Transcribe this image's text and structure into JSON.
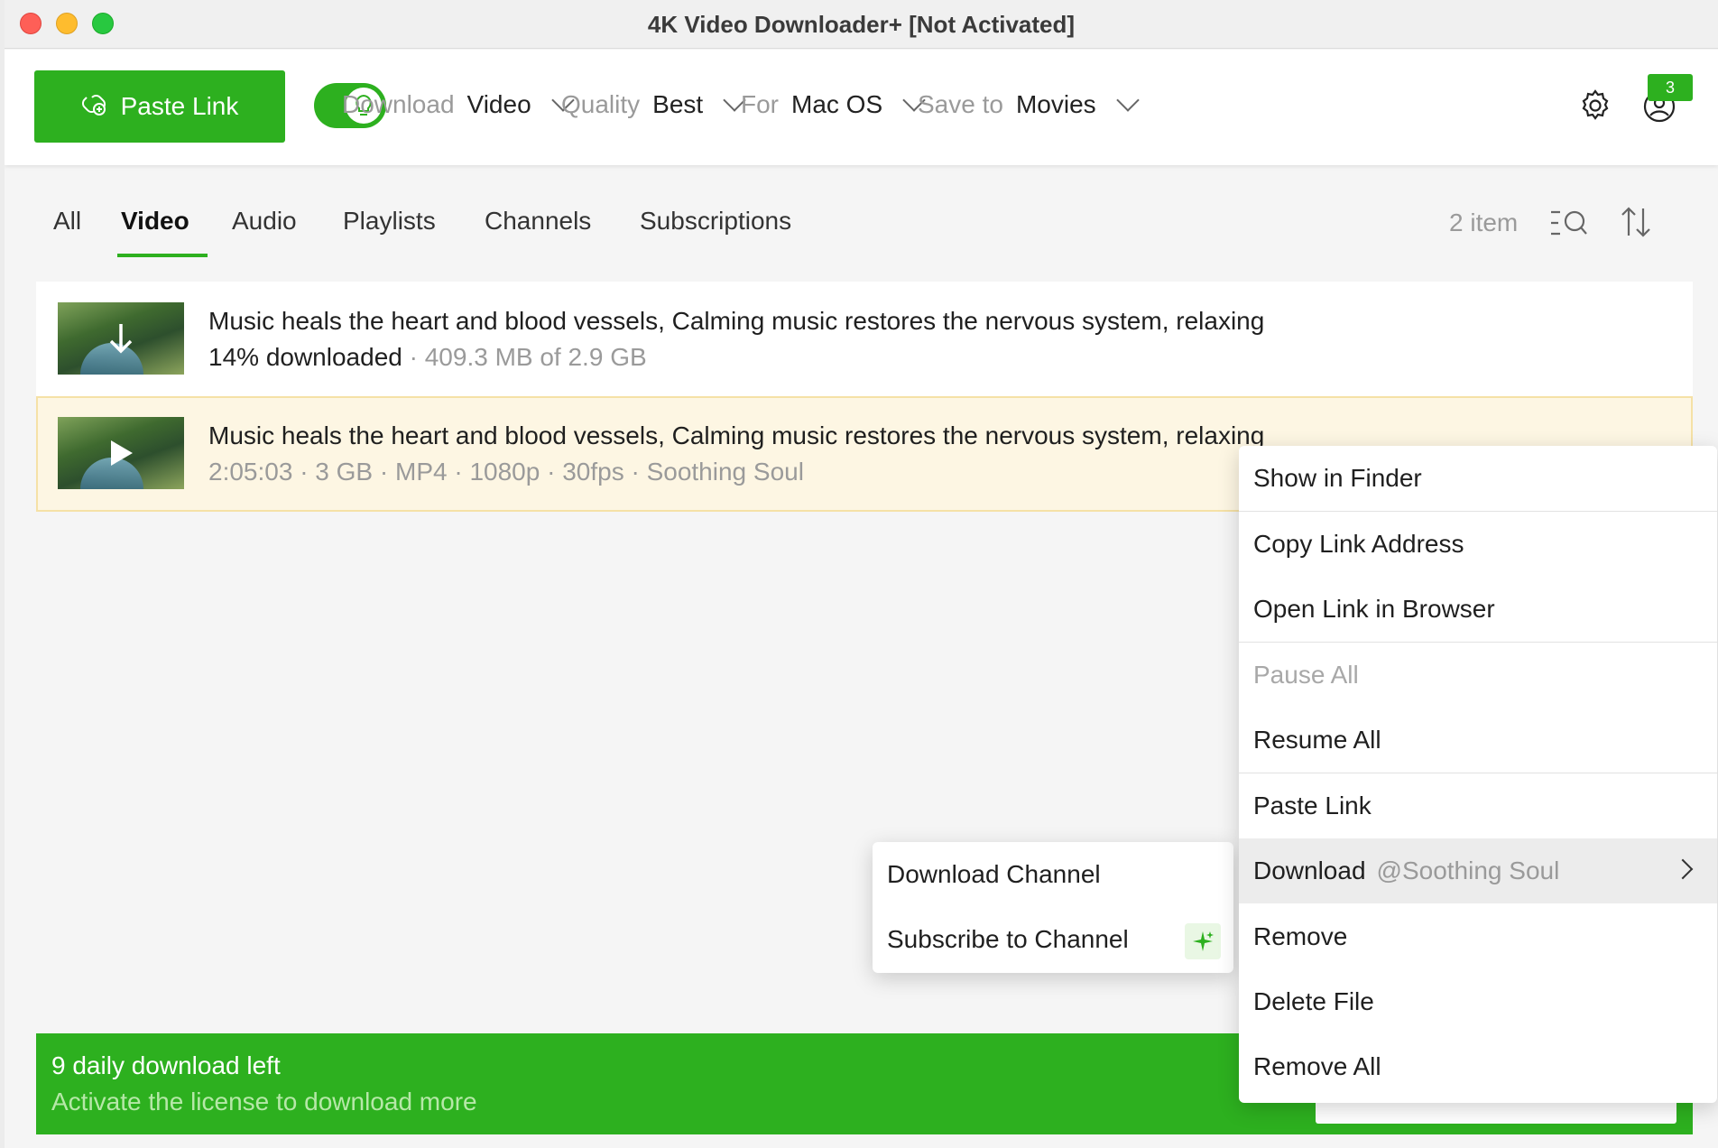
{
  "window": {
    "title": "4K Video Downloader+ [Not Activated]"
  },
  "toolbar": {
    "paste_link_label": "Paste Link",
    "download_label": "Download",
    "download_value": "Video",
    "quality_label": "Quality",
    "quality_value": "Best",
    "for_label": "For",
    "for_value": "Mac OS",
    "save_label": "Save to",
    "save_value": "Movies",
    "notifications_count": "3",
    "accent_color": "#2db01f"
  },
  "tabs": [
    {
      "label": "All"
    },
    {
      "label": "Video"
    },
    {
      "label": "Audio"
    },
    {
      "label": "Playlists"
    },
    {
      "label": "Channels"
    },
    {
      "label": "Subscriptions"
    }
  ],
  "list": {
    "count_text": "2 item",
    "items": [
      {
        "title": "Music heals the heart and blood vessels, Calming music restores the nervous system, relaxing",
        "progress": "14% downloaded",
        "size": " · 409.3 MB of 2.9 GB",
        "status_icon": "download-arrow-icon"
      },
      {
        "title": "Music heals the heart and blood vessels, Calming music restores the nervous system, relaxing",
        "meta": "2:05:03 · 3 GB · MP4 · 1080p · 30fps · Soothing Soul",
        "status_icon": "play-icon"
      }
    ]
  },
  "banner": {
    "line1": "9 daily download left",
    "line2": "Activate the license to download more"
  },
  "context_menu": {
    "items": [
      {
        "label": "Show in Finder"
      },
      {
        "label": "Copy Link Address"
      },
      {
        "label": "Open Link in Browser"
      },
      {
        "label": "Pause All"
      },
      {
        "label": "Resume All"
      },
      {
        "label": "Paste Link"
      },
      {
        "label": "Download",
        "muted": "@Soothing Soul"
      },
      {
        "label": "Remove"
      },
      {
        "label": "Delete File"
      },
      {
        "label": "Remove All"
      }
    ]
  },
  "submenu": {
    "items": [
      {
        "label": "Download Channel"
      },
      {
        "label": "Subscribe to Channel"
      }
    ]
  }
}
